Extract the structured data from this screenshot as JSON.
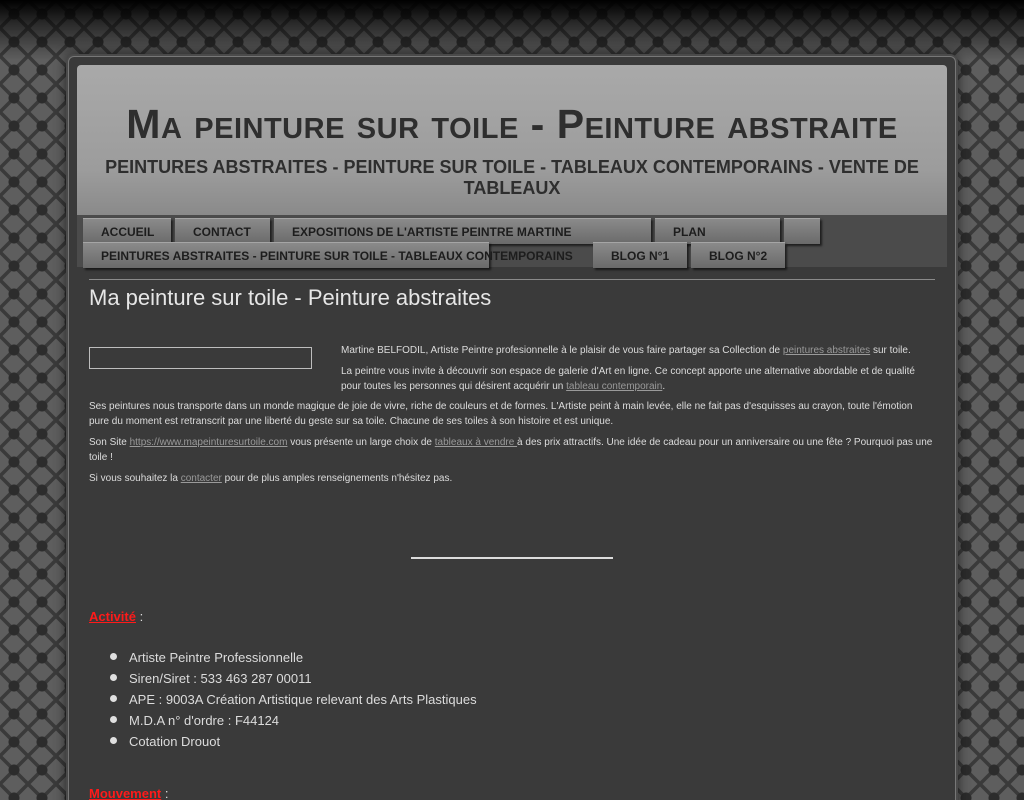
{
  "header": {
    "title": "Ma peinture sur toile - Peinture abstraite",
    "slogan": "PEINTURES ABSTRAITES - PEINTURE SUR TOILE - TABLEAUX CONTEMPORAINS - VENTE DE TABLEAUX"
  },
  "nav": {
    "items": [
      {
        "label": "ACCUEIL"
      },
      {
        "label": "CONTACT"
      },
      {
        "label": "EXPOSITIONS DE L'ARTISTE PEINTRE MARTINE"
      },
      {
        "label": "PLAN"
      },
      {
        "label": ""
      },
      {
        "label": "PEINTURES ABSTRAITES - PEINTURE SUR TOILE - TABLEAUX CONTEMPORAINS"
      },
      {
        "label": "BLOG N°1"
      },
      {
        "label": "BLOG N°2"
      }
    ]
  },
  "main": {
    "heading": "Ma peinture sur toile - Peinture abstraites",
    "p1": {
      "before": "Martine BELFODIL, Artiste Peintre profesionnelle à le plaisir de vous faire partager sa Collection de ",
      "link": "peintures abstraites",
      "after": " sur toile."
    },
    "p2": {
      "before": "La peintre vous invite à découvrir son espace de galerie d'Art en ligne. Ce concept apporte une alternative abordable et de qualité pour toutes les personnes qui désirent acquérir un ",
      "link": "tableau contemporain",
      "after": "."
    },
    "p3": "Ses peintures nous transporte dans un monde magique de joie de vivre, riche de couleurs et de formes. L'Artiste peint à main levée, elle ne fait pas d'esquisses au crayon, toute l'émotion pure du moment est retranscrit par une liberté du geste sur sa toile. Chacune de ses toiles à son histoire et est unique.",
    "p4": {
      "before": "Son Site ",
      "link1": "https://www.mapeinturesurtoile.com",
      "middle": " vous présente un large choix de ",
      "link2": "tableaux à vendre ",
      "after": " à des prix attractifs. Une idée de cadeau pour un anniversaire ou une fête ? Pourquoi pas une toile !"
    },
    "p5": {
      "before": "Si vous souhaitez la ",
      "link": "contacter",
      "after": " pour de plus amples renseignements n'hésitez pas."
    },
    "activite": {
      "title": "Activité",
      "suffix": " :"
    },
    "list": [
      "Artiste Peintre Professionnelle",
      "Siren/Siret : 533 463 287 00011",
      "APE : 9003A Création Artistique relevant des Arts Plastiques",
      "M.D.A n° d'ordre : F44124",
      "Cotation Drouot"
    ],
    "mouvement": {
      "title": "Mouvement",
      "suffix": " :"
    }
  },
  "colors": {
    "accent_red": "#ff1a1a",
    "link_gray": "#9a9a9a"
  }
}
